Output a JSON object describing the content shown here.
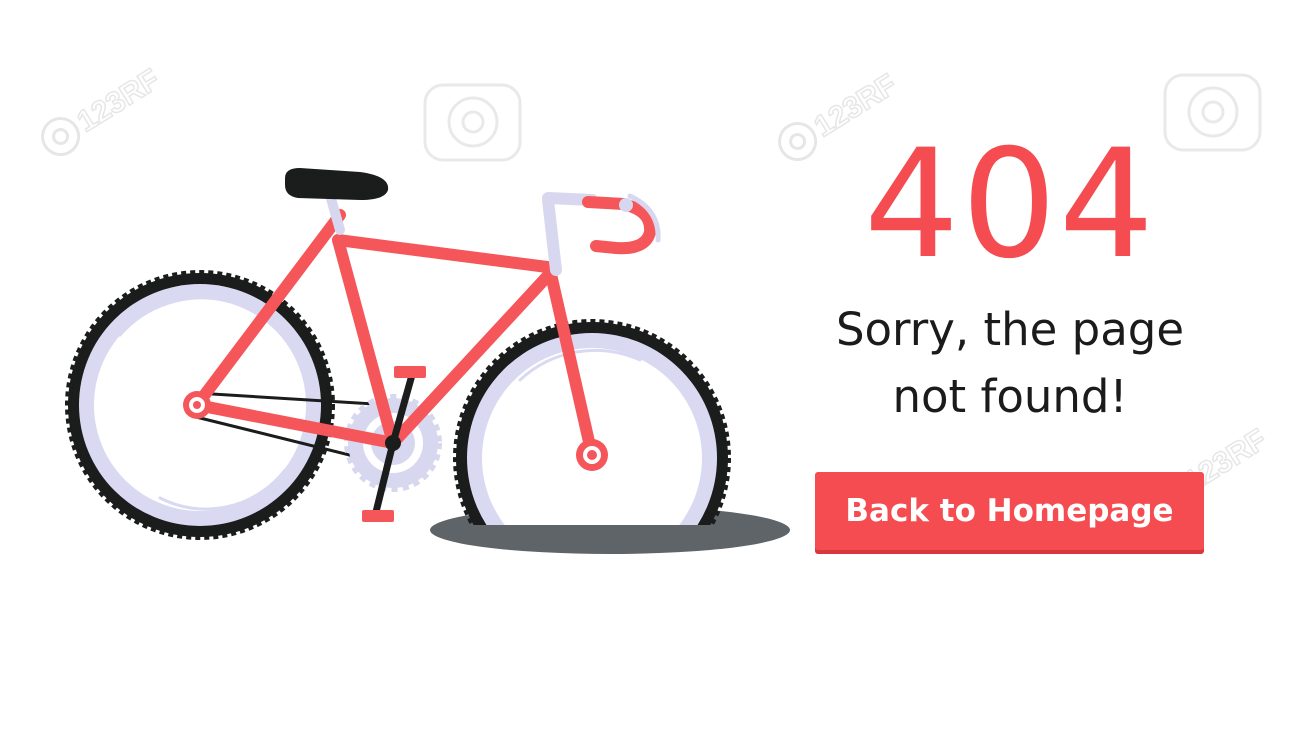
{
  "error": {
    "code": "404",
    "message": "Sorry, the page\nnot found!",
    "button_label": "Back to Homepage"
  },
  "watermark": {
    "text": "123RF"
  },
  "colors": {
    "accent": "#f44c50",
    "text": "#1b1b1b",
    "frame": "#f5565a",
    "tire": "#1a1d1c",
    "rim": "#d9daf2",
    "wheel_fill": "#ffffff",
    "hole": "#5e6468",
    "silver": "#d7d8ef"
  },
  "icons": {
    "illustration": "broken-bicycle-in-pothole",
    "watermark": "camera-aperture-watermark"
  }
}
